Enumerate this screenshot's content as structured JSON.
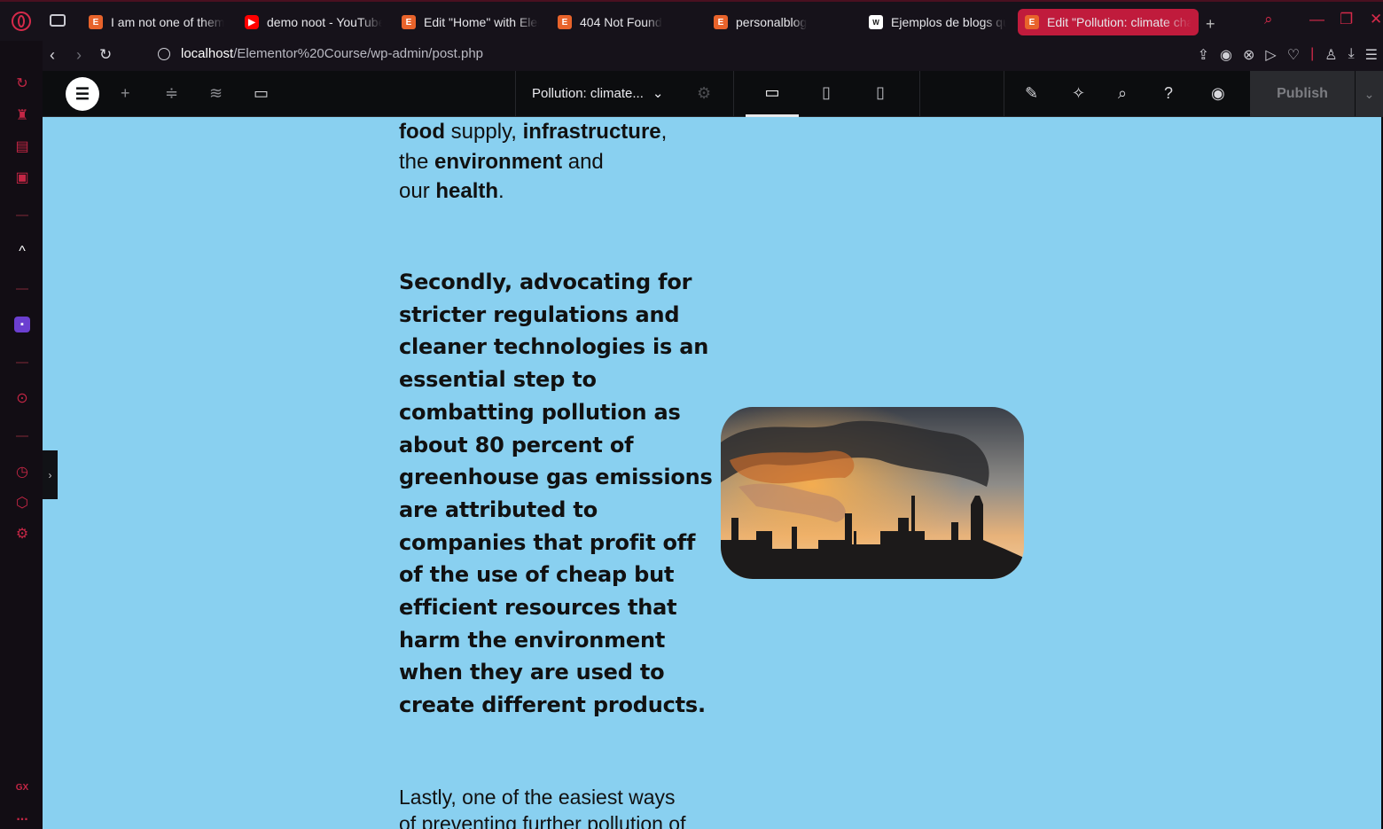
{
  "browser": {
    "tabs": [
      {
        "label": "I am not one of them",
        "favicon": "elementor"
      },
      {
        "label": "demo noot - YouTube",
        "favicon": "youtube"
      },
      {
        "label": "Edit \"Home\" with Elementor",
        "favicon": "elementor"
      },
      {
        "label": "404 Not Found",
        "favicon": "elementor"
      },
      {
        "label": "personalblog",
        "favicon": "elementor"
      },
      {
        "label": "Ejemplos de blogs que",
        "favicon": "wix"
      },
      {
        "label": "Edit \"Pollution: climate change\"",
        "favicon": "elementor",
        "active": true
      }
    ],
    "url_host": "localhost",
    "url_path": "/Elementor%20Course/wp-admin/post.php"
  },
  "sidebar": {
    "footer_label": "GX",
    "more_label": "..."
  },
  "elementor": {
    "document_title": "Pollution: climate...",
    "publish_label": "Publish"
  },
  "content": {
    "para1": {
      "line1_a": "food",
      "line1_b": " supply, ",
      "line1_c": "infrastructure",
      "line1_d": ",",
      "line2_a": "the ",
      "line2_b": "environment",
      "line2_c": " and",
      "line3_a": "our ",
      "line3_b": "health",
      "line3_c": "."
    },
    "para2_lines": [
      "Secondly, advocating for",
      "stricter regulations and",
      "cleaner technologies is an",
      "essential step to",
      "combatting pollution as",
      "about 80 percent of",
      "greenhouse gas emissions",
      "are attributed to",
      "companies that profit off",
      "of the use of cheap but",
      "efficient resources that",
      "harm the environment",
      "when they are used to",
      "create different products."
    ],
    "para3_line1": "Lastly, one of the easiest ways",
    "para3_line2": "of preventing further pollution of"
  },
  "colors": {
    "canvas_bg": "#89d0f0",
    "accent": "#c01b3c",
    "elementor_bar": "#0c0d0f"
  }
}
